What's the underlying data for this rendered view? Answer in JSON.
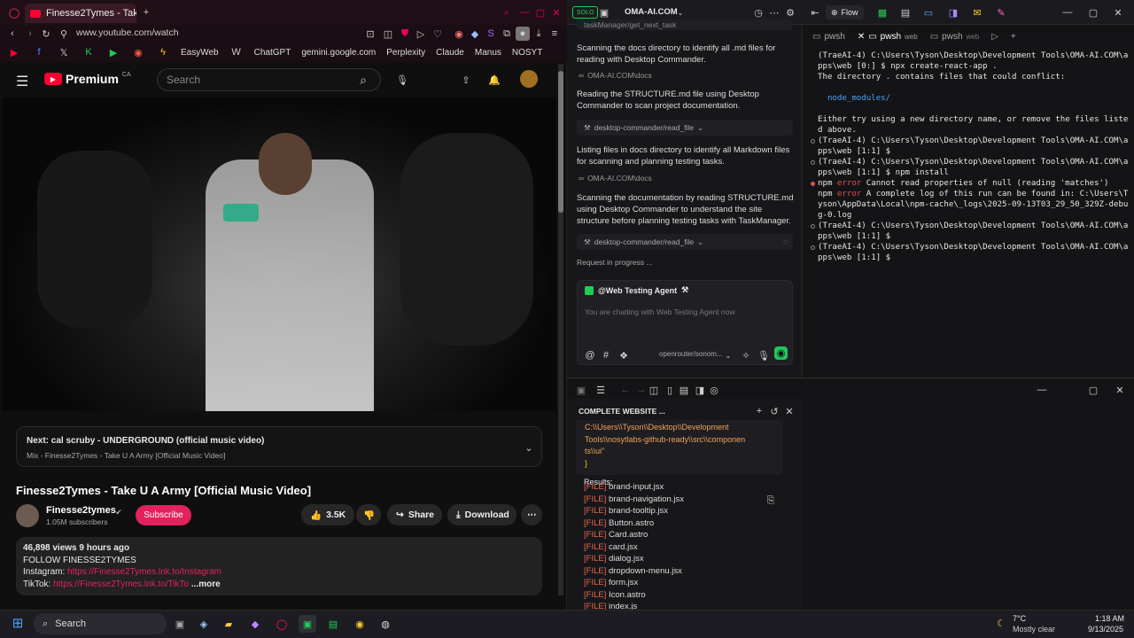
{
  "browser": {
    "tab_title": "Finesse2Tymes - Take",
    "url": "www.youtube.com/watch",
    "bookmarks": [
      "EasyWeb",
      "ChatGPT",
      "gemini.google.com",
      "Perplexity",
      "Claude",
      "Manus",
      "NOSYT"
    ]
  },
  "youtube": {
    "logo": "Premium",
    "logo_region": "CA",
    "search_placeholder": "Search",
    "next_title": "Next: cal scruby - UNDERGROUND (official music video)",
    "next_sub": "Mix - Finesse2Tymes - Take U A Army [Official Music Video]",
    "video_title": "Finesse2Tymes - Take U A Army [Official Music Video]",
    "channel": "Finesse2tymes",
    "subscribers": "1.05M subscribers",
    "subscribe_label": "Subscribe",
    "likes": "3.5K",
    "share_label": "Share",
    "download_label": "Download",
    "desc_meta": "46,898 views  9 hours ago",
    "desc_line1": "FOLLOW FINESSE2TYMES",
    "desc_insta_label": "Instagram:",
    "desc_insta_link": "https://Finesse2Tymes.lnk.to/Instagram",
    "desc_tiktok_label": "TikTok:",
    "desc_tiktok_link": "https://Finesse2Tymes.lnk.to/TikTo",
    "more_label": "...more"
  },
  "trae": {
    "solo_label": "SOLO",
    "project": "OMA-AI.COM",
    "flow_label": "Flow",
    "top_tool": "taskManager/get_next_task",
    "steps": [
      "Scanning the docs directory to identify all .md files for reading with Desktop Commander.",
      "Reading the STRUCTURE.md file using Desktop Commander to scan project documentation.",
      "Listing files in docs directory to identify all Markdown files for scanning and planning testing tasks.",
      "Scanning the documentation by reading STRUCTURE.md using Desktop Commander to understand the site structure before planning testing tasks with TaskManager."
    ],
    "links": [
      "OMA-AI.COM\\docs",
      "OMA-AI.COM\\docs"
    ],
    "tools": [
      "desktop-commander/read_file",
      "desktop-commander/read_file"
    ],
    "status": "Request in progress ...",
    "agent": "@Web Testing Agent",
    "chat_placeholder": "You are chatting with Web Testing Agent now",
    "model": "openrouter/sonom..."
  },
  "terminal": {
    "tabs": [
      "pwsh",
      "pwsh",
      "pwsh"
    ],
    "tab_tags": [
      "",
      "web",
      "web"
    ],
    "lines": [
      {
        "t": "(TraeAI-4) C:\\Users\\Tyson\\Desktop\\Development Tools\\OMA-AI.COM\\a",
        "dot": ""
      },
      {
        "t": "pps\\web [0:] $ npx create-react-app .",
        "dot": "none"
      },
      {
        "t": "The directory . contains files that could conflict:",
        "dot": "none"
      },
      {
        "t": "",
        "dot": "none"
      },
      {
        "t": "  node_modules/",
        "dot": "none"
      },
      {
        "t": "",
        "dot": "none"
      },
      {
        "t": "Either try using a new directory name, or remove the files liste",
        "dot": "none"
      },
      {
        "t": "d above.",
        "dot": "none"
      },
      {
        "t": "(TraeAI-4) C:\\Users\\Tyson\\Desktop\\Development Tools\\OMA-AI.COM\\a",
        "dot": "o"
      },
      {
        "t": "pps\\web [1:1] $",
        "dot": "none"
      },
      {
        "t": "(TraeAI-4) C:\\Users\\Tyson\\Desktop\\Development Tools\\OMA-AI.COM\\a",
        "dot": "o"
      },
      {
        "t": "pps\\web [1:1] $ npm install",
        "dot": "none"
      },
      {
        "t": "npm error Cannot read properties of null (reading 'matches')",
        "dot": "r"
      },
      {
        "t": "npm error A complete log of this run can be found in: C:\\Users\\T",
        "dot": "none"
      },
      {
        "t": "yson\\AppData\\Local\\npm-cache\\_logs\\2025-09-13T03_29_50_329Z-debu",
        "dot": "none"
      },
      {
        "t": "g-0.log",
        "dot": "none"
      },
      {
        "t": "(TraeAI-4) C:\\Users\\Tyson\\Desktop\\Development Tools\\OMA-AI.COM\\a",
        "dot": "o"
      },
      {
        "t": "pps\\web [1:1] $",
        "dot": "none"
      },
      {
        "t": "(TraeAI-4) C:\\Users\\Tyson\\Desktop\\Development Tools\\OMA-AI.COM\\a",
        "dot": "o"
      },
      {
        "t": "pps\\web [1:1] $ ",
        "dot": "none"
      }
    ]
  },
  "bottom": {
    "title": "COMPLETE WEBSITE ...",
    "code_lines": [
      "C:\\\\Users\\\\Tyson\\\\Desktop\\\\Development",
      "Tools\\\\nosytlabs-github-ready\\\\src\\\\componen",
      "ts\\\\ui\"",
      "}"
    ],
    "results_label": "Results:",
    "file_tag": "[FILE]",
    "files": [
      "brand-input.jsx",
      "brand-navigation.jsx",
      "brand-tooltip.jsx",
      "Button.astro",
      "Card.astro",
      "card.jsx",
      "dialog.jsx",
      "dropdown-menu.jsx",
      "form.jsx",
      "Icon.astro",
      "index.js"
    ]
  },
  "taskbar": {
    "search": "Search",
    "weather_temp": "7°C",
    "weather_desc": "Mostly clear",
    "time": "1:18 AM",
    "date": "9/13/2025"
  },
  "colors": {
    "yt_red": "#ff0033",
    "subscribe": "#e2225c",
    "accent_green": "#23c55e",
    "link_blue": "#3ea6ff"
  }
}
